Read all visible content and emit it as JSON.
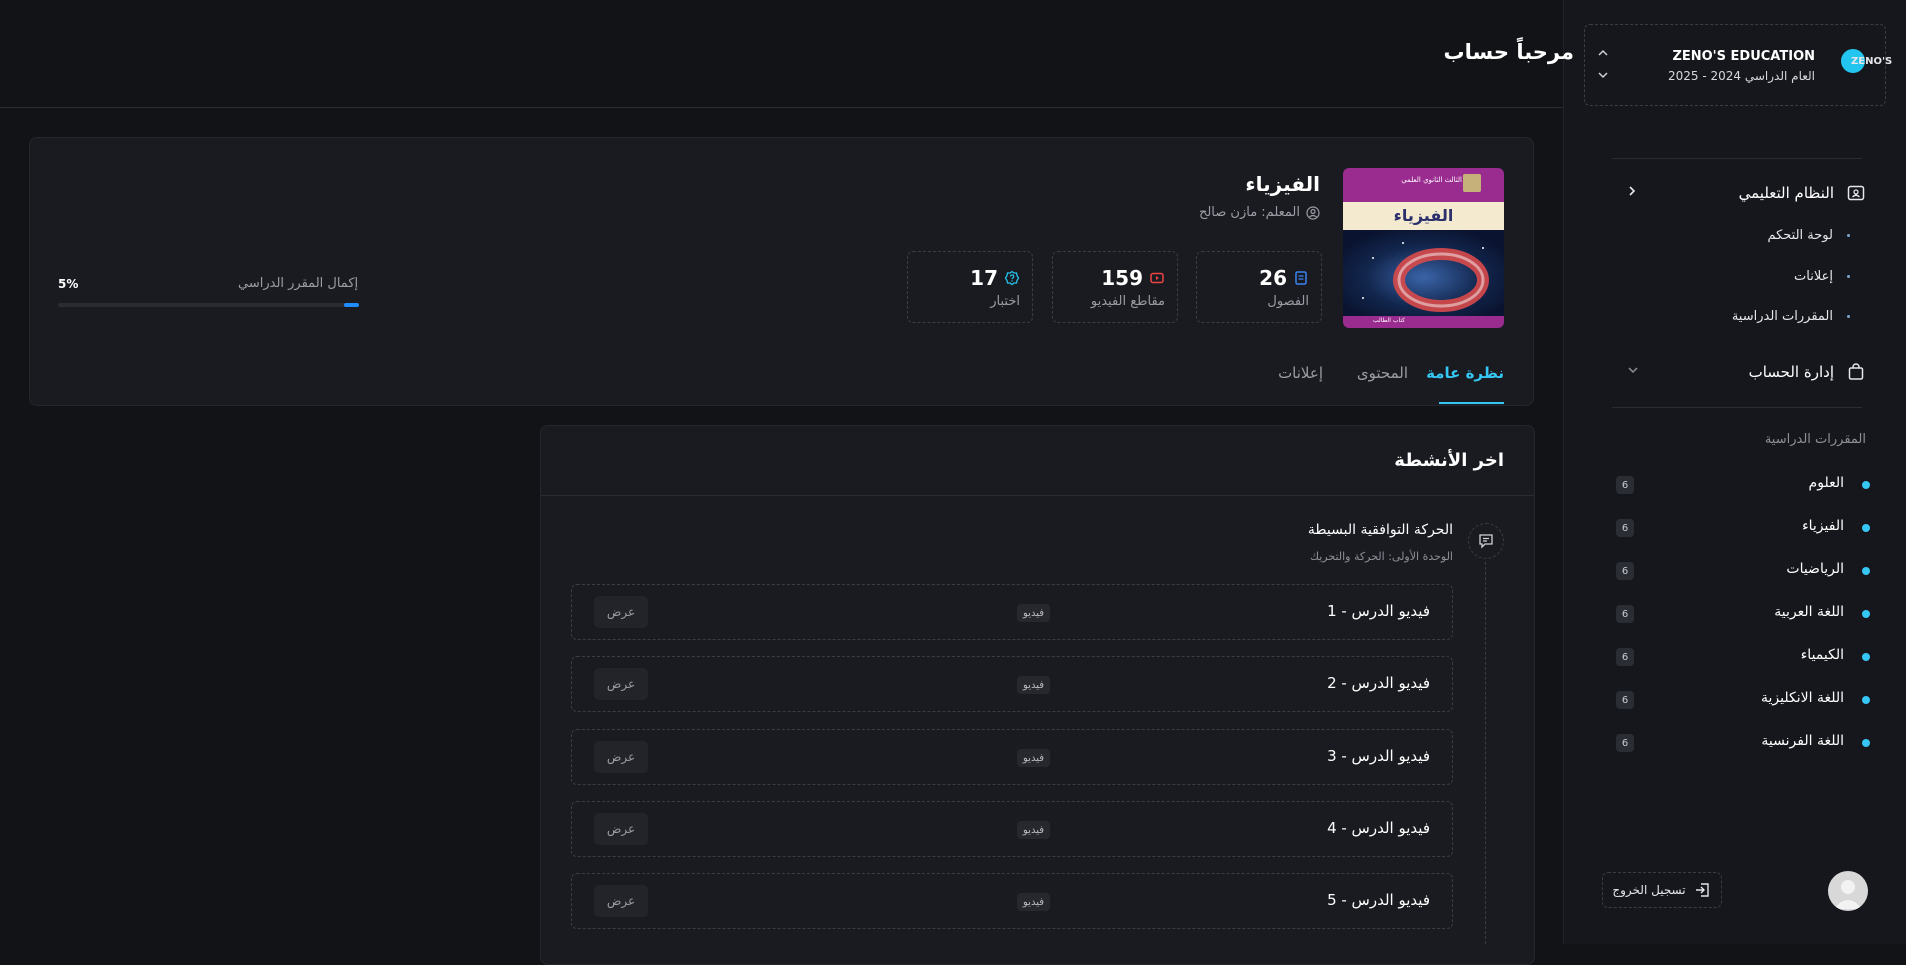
{
  "org": {
    "title": "ZENO'S EDUCATION",
    "year": "العام الدراسي 2024 - 2025",
    "logo_text": "ZENO'S"
  },
  "nav": {
    "system": {
      "label": "النظام التعليمي",
      "items": [
        "لوحة التحكم",
        "إعلانات",
        "المقررات الدراسية"
      ]
    },
    "account": {
      "label": "إدارة الحساب"
    }
  },
  "courses_section": {
    "title": "المقررات الدراسية",
    "items": [
      {
        "name": "العلوم",
        "count": "6"
      },
      {
        "name": "الفيزياء",
        "count": "6"
      },
      {
        "name": "الرياضيات",
        "count": "6"
      },
      {
        "name": "اللغة العربية",
        "count": "6"
      },
      {
        "name": "الكيمياء",
        "count": "6"
      },
      {
        "name": "اللغة الانكليزية",
        "count": "6"
      },
      {
        "name": "اللغة الفرنسية",
        "count": "6"
      }
    ]
  },
  "logout": "تسجيل الخروج",
  "header": {
    "welcome": "مرحباً حساب"
  },
  "course": {
    "title": "الفيزياء",
    "teacher": "المعلم: مازن صالح",
    "cover": {
      "grade": "الثالث الثانوي العلمي",
      "title": "الفيزياء",
      "footer": "كتاب الطالب"
    },
    "stats": [
      {
        "value": "26",
        "label": "الفصول",
        "icon": "book-icon",
        "color": "#3b82f6"
      },
      {
        "value": "159",
        "label": "مقاطع الفيديو",
        "icon": "video-icon",
        "color": "#ef4444"
      },
      {
        "value": "17",
        "label": "اختبار",
        "icon": "quiz-icon",
        "color": "#22c5ee"
      }
    ],
    "progress": {
      "label": "إكمال المقرر الدراسي",
      "percent_text": "5%",
      "value": 5
    }
  },
  "tabs": [
    "نظرة عامة",
    "المحتوى",
    "إعلانات"
  ],
  "activity": {
    "title": "اخر الأنشطة",
    "item": {
      "name": "الحركة التوافقية البسيطة",
      "unit": "الوحدة الأولى: الحركة والتحريك"
    },
    "lessons": [
      {
        "title": "فيديو الدرس - 1",
        "type": "فيديو",
        "action": "عرض"
      },
      {
        "title": "فيديو الدرس - 2",
        "type": "فيديو",
        "action": "عرض"
      },
      {
        "title": "فيديو الدرس - 3",
        "type": "فيديو",
        "action": "عرض"
      },
      {
        "title": "فيديو الدرس - 4",
        "type": "فيديو",
        "action": "عرض"
      },
      {
        "title": "فيديو الدرس - 5",
        "type": "فيديو",
        "action": "عرض"
      }
    ]
  },
  "colors": {
    "accent": "#36c6f4",
    "progress": "#1e8bff",
    "background": "#121317",
    "card": "#1a1b20"
  }
}
